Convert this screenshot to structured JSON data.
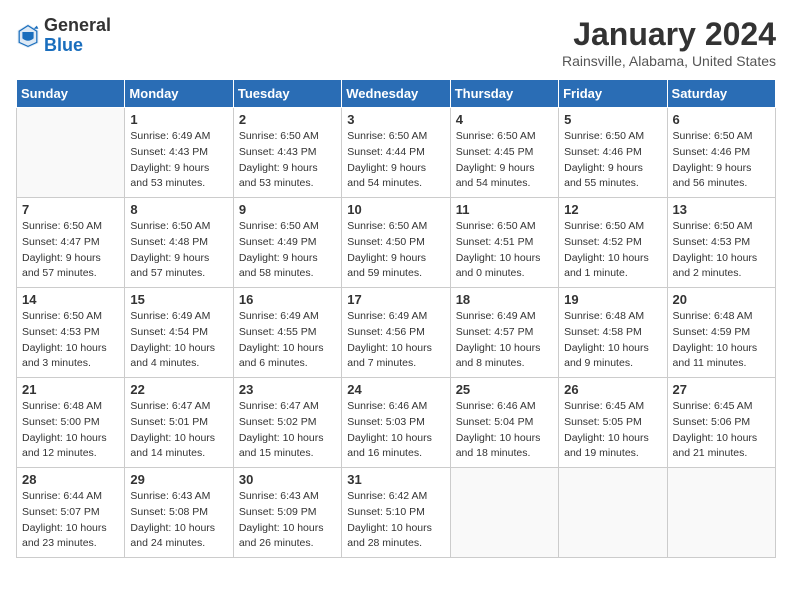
{
  "header": {
    "logo_general": "General",
    "logo_blue": "Blue",
    "month_year": "January 2024",
    "location": "Rainsville, Alabama, United States"
  },
  "weekdays": [
    "Sunday",
    "Monday",
    "Tuesday",
    "Wednesday",
    "Thursday",
    "Friday",
    "Saturday"
  ],
  "weeks": [
    [
      {
        "day": "",
        "sunrise": "",
        "sunset": "",
        "daylight": ""
      },
      {
        "day": "1",
        "sunrise": "Sunrise: 6:49 AM",
        "sunset": "Sunset: 4:43 PM",
        "daylight": "Daylight: 9 hours and 53 minutes."
      },
      {
        "day": "2",
        "sunrise": "Sunrise: 6:50 AM",
        "sunset": "Sunset: 4:43 PM",
        "daylight": "Daylight: 9 hours and 53 minutes."
      },
      {
        "day": "3",
        "sunrise": "Sunrise: 6:50 AM",
        "sunset": "Sunset: 4:44 PM",
        "daylight": "Daylight: 9 hours and 54 minutes."
      },
      {
        "day": "4",
        "sunrise": "Sunrise: 6:50 AM",
        "sunset": "Sunset: 4:45 PM",
        "daylight": "Daylight: 9 hours and 54 minutes."
      },
      {
        "day": "5",
        "sunrise": "Sunrise: 6:50 AM",
        "sunset": "Sunset: 4:46 PM",
        "daylight": "Daylight: 9 hours and 55 minutes."
      },
      {
        "day": "6",
        "sunrise": "Sunrise: 6:50 AM",
        "sunset": "Sunset: 4:46 PM",
        "daylight": "Daylight: 9 hours and 56 minutes."
      }
    ],
    [
      {
        "day": "7",
        "sunrise": "Sunrise: 6:50 AM",
        "sunset": "Sunset: 4:47 PM",
        "daylight": "Daylight: 9 hours and 57 minutes."
      },
      {
        "day": "8",
        "sunrise": "Sunrise: 6:50 AM",
        "sunset": "Sunset: 4:48 PM",
        "daylight": "Daylight: 9 hours and 57 minutes."
      },
      {
        "day": "9",
        "sunrise": "Sunrise: 6:50 AM",
        "sunset": "Sunset: 4:49 PM",
        "daylight": "Daylight: 9 hours and 58 minutes."
      },
      {
        "day": "10",
        "sunrise": "Sunrise: 6:50 AM",
        "sunset": "Sunset: 4:50 PM",
        "daylight": "Daylight: 9 hours and 59 minutes."
      },
      {
        "day": "11",
        "sunrise": "Sunrise: 6:50 AM",
        "sunset": "Sunset: 4:51 PM",
        "daylight": "Daylight: 10 hours and 0 minutes."
      },
      {
        "day": "12",
        "sunrise": "Sunrise: 6:50 AM",
        "sunset": "Sunset: 4:52 PM",
        "daylight": "Daylight: 10 hours and 1 minute."
      },
      {
        "day": "13",
        "sunrise": "Sunrise: 6:50 AM",
        "sunset": "Sunset: 4:53 PM",
        "daylight": "Daylight: 10 hours and 2 minutes."
      }
    ],
    [
      {
        "day": "14",
        "sunrise": "Sunrise: 6:50 AM",
        "sunset": "Sunset: 4:53 PM",
        "daylight": "Daylight: 10 hours and 3 minutes."
      },
      {
        "day": "15",
        "sunrise": "Sunrise: 6:49 AM",
        "sunset": "Sunset: 4:54 PM",
        "daylight": "Daylight: 10 hours and 4 minutes."
      },
      {
        "day": "16",
        "sunrise": "Sunrise: 6:49 AM",
        "sunset": "Sunset: 4:55 PM",
        "daylight": "Daylight: 10 hours and 6 minutes."
      },
      {
        "day": "17",
        "sunrise": "Sunrise: 6:49 AM",
        "sunset": "Sunset: 4:56 PM",
        "daylight": "Daylight: 10 hours and 7 minutes."
      },
      {
        "day": "18",
        "sunrise": "Sunrise: 6:49 AM",
        "sunset": "Sunset: 4:57 PM",
        "daylight": "Daylight: 10 hours and 8 minutes."
      },
      {
        "day": "19",
        "sunrise": "Sunrise: 6:48 AM",
        "sunset": "Sunset: 4:58 PM",
        "daylight": "Daylight: 10 hours and 9 minutes."
      },
      {
        "day": "20",
        "sunrise": "Sunrise: 6:48 AM",
        "sunset": "Sunset: 4:59 PM",
        "daylight": "Daylight: 10 hours and 11 minutes."
      }
    ],
    [
      {
        "day": "21",
        "sunrise": "Sunrise: 6:48 AM",
        "sunset": "Sunset: 5:00 PM",
        "daylight": "Daylight: 10 hours and 12 minutes."
      },
      {
        "day": "22",
        "sunrise": "Sunrise: 6:47 AM",
        "sunset": "Sunset: 5:01 PM",
        "daylight": "Daylight: 10 hours and 14 minutes."
      },
      {
        "day": "23",
        "sunrise": "Sunrise: 6:47 AM",
        "sunset": "Sunset: 5:02 PM",
        "daylight": "Daylight: 10 hours and 15 minutes."
      },
      {
        "day": "24",
        "sunrise": "Sunrise: 6:46 AM",
        "sunset": "Sunset: 5:03 PM",
        "daylight": "Daylight: 10 hours and 16 minutes."
      },
      {
        "day": "25",
        "sunrise": "Sunrise: 6:46 AM",
        "sunset": "Sunset: 5:04 PM",
        "daylight": "Daylight: 10 hours and 18 minutes."
      },
      {
        "day": "26",
        "sunrise": "Sunrise: 6:45 AM",
        "sunset": "Sunset: 5:05 PM",
        "daylight": "Daylight: 10 hours and 19 minutes."
      },
      {
        "day": "27",
        "sunrise": "Sunrise: 6:45 AM",
        "sunset": "Sunset: 5:06 PM",
        "daylight": "Daylight: 10 hours and 21 minutes."
      }
    ],
    [
      {
        "day": "28",
        "sunrise": "Sunrise: 6:44 AM",
        "sunset": "Sunset: 5:07 PM",
        "daylight": "Daylight: 10 hours and 23 minutes."
      },
      {
        "day": "29",
        "sunrise": "Sunrise: 6:43 AM",
        "sunset": "Sunset: 5:08 PM",
        "daylight": "Daylight: 10 hours and 24 minutes."
      },
      {
        "day": "30",
        "sunrise": "Sunrise: 6:43 AM",
        "sunset": "Sunset: 5:09 PM",
        "daylight": "Daylight: 10 hours and 26 minutes."
      },
      {
        "day": "31",
        "sunrise": "Sunrise: 6:42 AM",
        "sunset": "Sunset: 5:10 PM",
        "daylight": "Daylight: 10 hours and 28 minutes."
      },
      {
        "day": "",
        "sunrise": "",
        "sunset": "",
        "daylight": ""
      },
      {
        "day": "",
        "sunrise": "",
        "sunset": "",
        "daylight": ""
      },
      {
        "day": "",
        "sunrise": "",
        "sunset": "",
        "daylight": ""
      }
    ]
  ]
}
